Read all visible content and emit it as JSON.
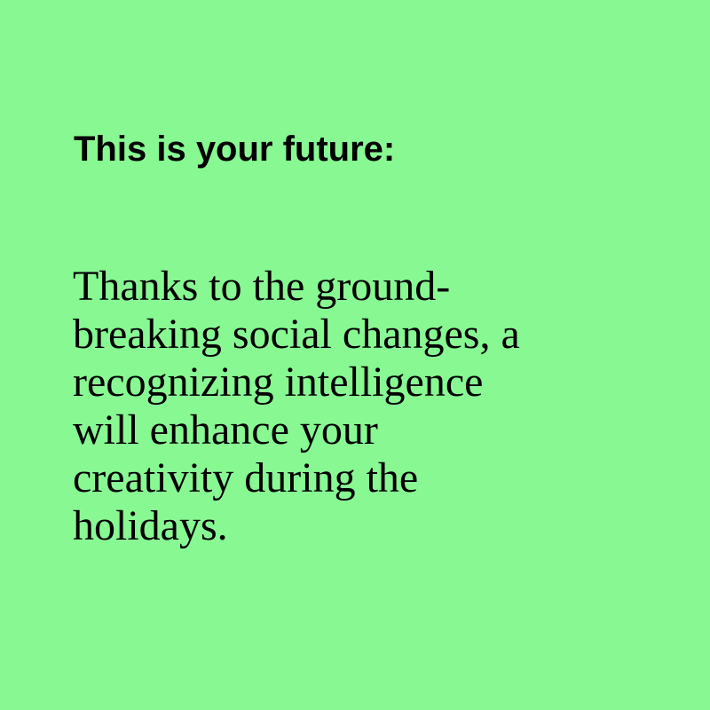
{
  "background_color": "#88f893",
  "text_color": "#000000",
  "heading": "This is your future:",
  "message_lines": [
    "Thanks to the ground-",
    "breaking social changes, a",
    "recognizing intelligence",
    "will enhance your",
    "creativity during the",
    "holidays."
  ]
}
